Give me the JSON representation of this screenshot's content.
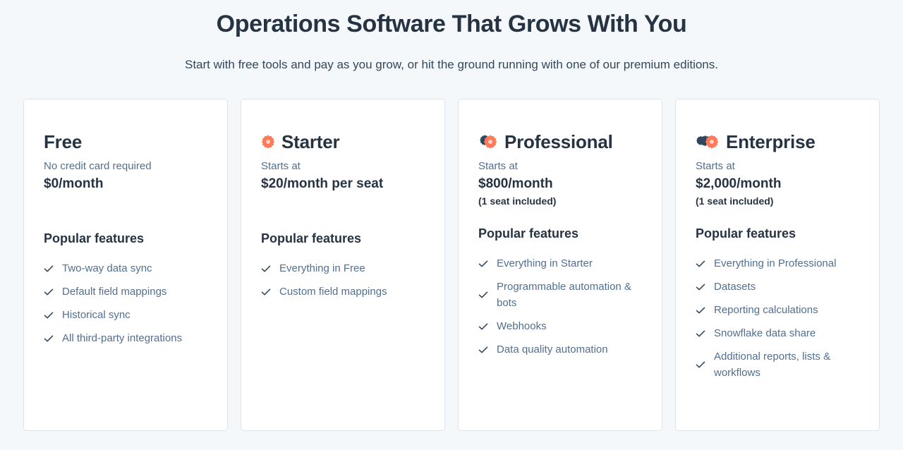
{
  "header": {
    "title": "Operations Software That Grows With You",
    "subtitle": "Start with free tools and pay as you grow, or hit the ground running with one of our premium editions."
  },
  "colors": {
    "background": "#f5f8fa",
    "card_background": "#ffffff",
    "card_border": "#dfe3eb",
    "heading": "#253342",
    "body_text": "#516f90",
    "accent_orange": "#ff7a59",
    "accent_orange_light": "#ffa68d",
    "accent_navy": "#2e475d"
  },
  "features_heading": "Popular features",
  "icons": {
    "check": "check-icon",
    "starter": "sprocket-single-icon",
    "professional": "sprocket-double-icon",
    "enterprise": "sprocket-triple-icon"
  },
  "plans": [
    {
      "name": "Free",
      "icon": "none",
      "tagline": "No credit card required",
      "price": "$0/month",
      "seat_note": "",
      "features_title": "Popular features",
      "features": [
        "Two-way data sync",
        "Default field mappings",
        "Historical sync",
        "All third-party integrations"
      ]
    },
    {
      "name": "Starter",
      "icon": "sprocket-single-icon",
      "tagline": "Starts at",
      "price": "$20/month per seat",
      "seat_note": "",
      "features_title": "Popular features",
      "features": [
        "Everything in Free",
        "Custom field mappings"
      ]
    },
    {
      "name": "Professional",
      "icon": "sprocket-double-icon",
      "tagline": "Starts at",
      "price": "$800/month",
      "seat_note": "(1 seat included)",
      "features_title": "Popular features",
      "features": [
        "Everything in Starter",
        "Programmable automation & bots",
        "Webhooks",
        "Data quality automation"
      ]
    },
    {
      "name": "Enterprise",
      "icon": "sprocket-triple-icon",
      "tagline": "Starts at",
      "price": "$2,000/month",
      "seat_note": "(1 seat included)",
      "features_title": "Popular features",
      "features": [
        "Everything in Professional",
        "Datasets",
        "Reporting calculations",
        "Snowflake data share",
        "Additional reports, lists & workflows"
      ]
    }
  ]
}
